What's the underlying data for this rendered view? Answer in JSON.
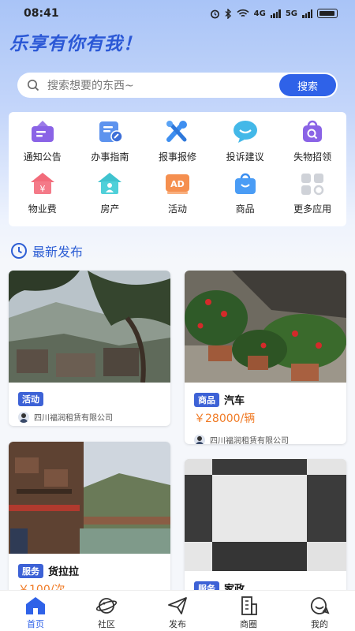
{
  "status": {
    "time": "08:41",
    "net1": "4G",
    "net2": "5G"
  },
  "slogan": "乐享有你有我！",
  "search": {
    "placeholder": "搜索想要的东西~",
    "button": "搜索"
  },
  "services": [
    {
      "label": "通知公告",
      "icon": "notice-board-icon"
    },
    {
      "label": "办事指南",
      "icon": "guide-doc-icon"
    },
    {
      "label": "报事报修",
      "icon": "repair-tools-icon"
    },
    {
      "label": "投诉建议",
      "icon": "chat-bubble-icon"
    },
    {
      "label": "失物招领",
      "icon": "lost-bag-icon"
    },
    {
      "label": "物业费",
      "icon": "yuan-house-icon"
    },
    {
      "label": "房产",
      "icon": "house-person-icon"
    },
    {
      "label": "活动",
      "icon": "ad-badge-icon"
    },
    {
      "label": "商品",
      "icon": "shopping-bag-icon"
    },
    {
      "label": "更多应用",
      "icon": "apps-grid-icon"
    }
  ],
  "section": {
    "title": "最新发布"
  },
  "posts": [
    {
      "tag": "活动",
      "title": "",
      "price": "",
      "publisher": "四川福润租赁有限公司"
    },
    {
      "tag": "商品",
      "title": "汽车",
      "price": "￥28000/辆",
      "publisher": "四川福润租赁有限公司"
    },
    {
      "tag": "服务",
      "title": "货拉拉",
      "price": "￥100/次",
      "publisher": ""
    },
    {
      "tag": "服务",
      "title": "家政",
      "price": "",
      "publisher": ""
    }
  ],
  "tabs": [
    {
      "label": "首页",
      "icon": "home-icon"
    },
    {
      "label": "社区",
      "icon": "planet-icon"
    },
    {
      "label": "发布",
      "icon": "paper-plane-icon"
    },
    {
      "label": "商圈",
      "icon": "building-icon"
    },
    {
      "label": "我的",
      "icon": "smile-face-icon"
    }
  ],
  "colors": {
    "accent": "#2f62e8",
    "price": "#f07b26",
    "tag": "#3d62d6"
  }
}
